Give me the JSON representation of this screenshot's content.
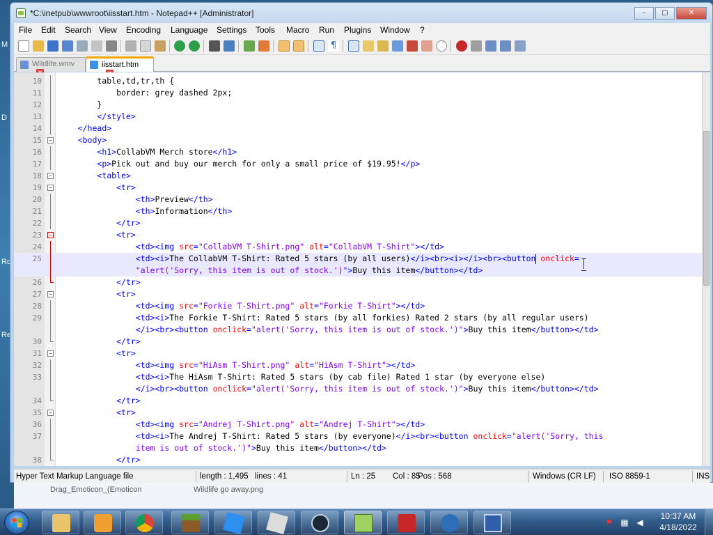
{
  "window": {
    "title": "*C:\\inetpub\\wwwroot\\iisstart.htm - Notepad++ [Administrator]",
    "minimize": "–",
    "maximize": "▢",
    "close": "✕"
  },
  "menu": [
    "File",
    "Edit",
    "Search",
    "View",
    "Encoding",
    "Language",
    "Settings",
    "Tools",
    "Macro",
    "Run",
    "Plugins",
    "Window",
    "?"
  ],
  "tabs": [
    {
      "label": "Wildlife.wmv",
      "active": false
    },
    {
      "label": "iisstart.htm",
      "active": true
    }
  ],
  "editor": {
    "current_line": 25,
    "lines": [
      {
        "n": "10",
        "fold": "line",
        "seg": [
          [
            "tx",
            "        table,td,tr,th {"
          ]
        ]
      },
      {
        "n": "11",
        "fold": "line",
        "seg": [
          [
            "tx",
            "            border: grey dashed 2px;"
          ]
        ]
      },
      {
        "n": "12",
        "fold": "line",
        "seg": [
          [
            "tx",
            "        }"
          ]
        ]
      },
      {
        "n": "13",
        "fold": "line",
        "seg": [
          [
            "tx",
            "        "
          ],
          [
            "t",
            "</style>"
          ]
        ]
      },
      {
        "n": "14",
        "fold": "line",
        "seg": [
          [
            "tx",
            "    "
          ],
          [
            "t",
            "</head>"
          ]
        ]
      },
      {
        "n": "15",
        "fold": "box",
        "seg": [
          [
            "tx",
            "    "
          ],
          [
            "t",
            "<body>"
          ]
        ]
      },
      {
        "n": "16",
        "fold": "line",
        "seg": [
          [
            "tx",
            "        "
          ],
          [
            "t",
            "<h1>"
          ],
          [
            "tx",
            "CollabVM Merch store"
          ],
          [
            "t",
            "</h1>"
          ]
        ]
      },
      {
        "n": "17",
        "fold": "line",
        "seg": [
          [
            "tx",
            "        "
          ],
          [
            "t",
            "<p>"
          ],
          [
            "tx",
            "Pick out and buy our merch for only a small price of $19.95!"
          ],
          [
            "t",
            "</p>"
          ]
        ]
      },
      {
        "n": "18",
        "fold": "box",
        "seg": [
          [
            "tx",
            "        "
          ],
          [
            "t",
            "<table>"
          ]
        ]
      },
      {
        "n": "19",
        "fold": "box",
        "seg": [
          [
            "tx",
            "            "
          ],
          [
            "t",
            "<tr>"
          ]
        ]
      },
      {
        "n": "20",
        "fold": "line",
        "seg": [
          [
            "tx",
            "                "
          ],
          [
            "t",
            "<th>"
          ],
          [
            "tx",
            "Preview"
          ],
          [
            "t",
            "</th>"
          ]
        ]
      },
      {
        "n": "21",
        "fold": "line",
        "seg": [
          [
            "tx",
            "                "
          ],
          [
            "t",
            "<th>"
          ],
          [
            "tx",
            "Information"
          ],
          [
            "t",
            "</th>"
          ]
        ]
      },
      {
        "n": "22",
        "fold": "line",
        "seg": [
          [
            "tx",
            "            "
          ],
          [
            "t",
            "</tr>"
          ]
        ]
      },
      {
        "n": "23",
        "fold": "boxred",
        "seg": [
          [
            "tx",
            "            "
          ],
          [
            "t",
            "<tr>"
          ]
        ]
      },
      {
        "n": "24",
        "fold": "linered",
        "seg": [
          [
            "tx",
            "                "
          ],
          [
            "t",
            "<td><img "
          ],
          [
            "a",
            "src"
          ],
          [
            "t",
            "="
          ],
          [
            "s",
            "\"CollabVM T-Shirt.png\""
          ],
          [
            "t",
            " "
          ],
          [
            "a",
            "alt"
          ],
          [
            "t",
            "="
          ],
          [
            "s",
            "\"CollabVM T-Shirt\""
          ],
          [
            "t",
            "></td>"
          ]
        ]
      },
      {
        "n": "25",
        "fold": "linered",
        "seg": [
          [
            "tx",
            "                "
          ],
          [
            "t",
            "<td><i>"
          ],
          [
            "tx",
            "The CollabVM T-Shirt: Rated 5 stars (by all users)"
          ],
          [
            "t",
            "</i><br><i></i><br><button "
          ],
          [
            "a",
            "onclick"
          ],
          [
            "t",
            "="
          ]
        ]
      },
      {
        "n": "",
        "fold": "linered",
        "seg": [
          [
            "tx",
            "                "
          ],
          [
            "s",
            "\"alert('Sorry, this item is out of stock.')\""
          ],
          [
            "t",
            ">"
          ],
          [
            "tx",
            "Buy this item"
          ],
          [
            "t",
            "</button></td>"
          ]
        ]
      },
      {
        "n": "26",
        "fold": "endred",
        "seg": [
          [
            "tx",
            "            "
          ],
          [
            "t",
            "</tr>"
          ]
        ]
      },
      {
        "n": "27",
        "fold": "box",
        "seg": [
          [
            "tx",
            "            "
          ],
          [
            "t",
            "<tr>"
          ]
        ]
      },
      {
        "n": "28",
        "fold": "line",
        "seg": [
          [
            "tx",
            "                "
          ],
          [
            "t",
            "<td><img "
          ],
          [
            "a",
            "src"
          ],
          [
            "t",
            "="
          ],
          [
            "s",
            "\"Forkie T-Shirt.png\""
          ],
          [
            "t",
            " "
          ],
          [
            "a",
            "alt"
          ],
          [
            "t",
            "="
          ],
          [
            "s",
            "\"Forkie T-Shirt\""
          ],
          [
            "t",
            "></td>"
          ]
        ]
      },
      {
        "n": "29",
        "fold": "line",
        "seg": [
          [
            "tx",
            "                "
          ],
          [
            "t",
            "<td><i>"
          ],
          [
            "tx",
            "The Forkie T-Shirt: Rated 5 stars (by all forkies) Rated 2 stars (by all regular users)"
          ]
        ]
      },
      {
        "n": "",
        "fold": "line",
        "seg": [
          [
            "tx",
            "                "
          ],
          [
            "t",
            "</i><br><button "
          ],
          [
            "a",
            "onclick"
          ],
          [
            "t",
            "="
          ],
          [
            "s",
            "\"alert('Sorry, this item is out of stock.')\""
          ],
          [
            "t",
            ">"
          ],
          [
            "tx",
            "Buy this item"
          ],
          [
            "t",
            "</button></td>"
          ]
        ]
      },
      {
        "n": "30",
        "fold": "end",
        "seg": [
          [
            "tx",
            "            "
          ],
          [
            "t",
            "</tr>"
          ]
        ]
      },
      {
        "n": "31",
        "fold": "box",
        "seg": [
          [
            "tx",
            "            "
          ],
          [
            "t",
            "<tr>"
          ]
        ]
      },
      {
        "n": "32",
        "fold": "line",
        "seg": [
          [
            "tx",
            "                "
          ],
          [
            "t",
            "<td><img "
          ],
          [
            "a",
            "src"
          ],
          [
            "t",
            "="
          ],
          [
            "s",
            "\"HiAsm T-Shirt.png\""
          ],
          [
            "t",
            " "
          ],
          [
            "a",
            "alt"
          ],
          [
            "t",
            "="
          ],
          [
            "s",
            "\"HiAsm T-Shirt\""
          ],
          [
            "t",
            "></td>"
          ]
        ]
      },
      {
        "n": "33",
        "fold": "line",
        "seg": [
          [
            "tx",
            "                "
          ],
          [
            "t",
            "<td><i>"
          ],
          [
            "tx",
            "The HiAsm T-Shirt: Rated 5 stars (by cab file) Rated 1 star (by everyone else)"
          ]
        ]
      },
      {
        "n": "",
        "fold": "line",
        "seg": [
          [
            "tx",
            "                "
          ],
          [
            "t",
            "</i><br><button "
          ],
          [
            "a",
            "onclick"
          ],
          [
            "t",
            "="
          ],
          [
            "s",
            "\"alert('Sorry, this item is out of stock.')\""
          ],
          [
            "t",
            ">"
          ],
          [
            "tx",
            "Buy this item"
          ],
          [
            "t",
            "</button></td>"
          ]
        ]
      },
      {
        "n": "34",
        "fold": "end",
        "seg": [
          [
            "tx",
            "            "
          ],
          [
            "t",
            "</tr>"
          ]
        ]
      },
      {
        "n": "35",
        "fold": "box",
        "seg": [
          [
            "tx",
            "            "
          ],
          [
            "t",
            "<tr>"
          ]
        ]
      },
      {
        "n": "36",
        "fold": "line",
        "seg": [
          [
            "tx",
            "                "
          ],
          [
            "t",
            "<td><img "
          ],
          [
            "a",
            "src"
          ],
          [
            "t",
            "="
          ],
          [
            "s",
            "\"Andrej T-Shirt.png\""
          ],
          [
            "t",
            " "
          ],
          [
            "a",
            "alt"
          ],
          [
            "t",
            "="
          ],
          [
            "s",
            "\"Andrej T-Shirt\""
          ],
          [
            "t",
            "></td>"
          ]
        ]
      },
      {
        "n": "37",
        "fold": "line",
        "seg": [
          [
            "tx",
            "                "
          ],
          [
            "t",
            "<td><i>"
          ],
          [
            "tx",
            "The Andrej T-Shirt: Rated 5 stars (by everyone)"
          ],
          [
            "t",
            "</i><br><button "
          ],
          [
            "a",
            "onclick"
          ],
          [
            "t",
            "="
          ],
          [
            "s",
            "\"alert('Sorry, this"
          ]
        ]
      },
      {
        "n": "",
        "fold": "line",
        "seg": [
          [
            "tx",
            "                "
          ],
          [
            "s",
            "item is out of stock.')\""
          ],
          [
            "t",
            ">"
          ],
          [
            "tx",
            "Buy this item"
          ],
          [
            "t",
            "</button></td>"
          ]
        ]
      },
      {
        "n": "38",
        "fold": "end",
        "seg": [
          [
            "tx",
            "            "
          ],
          [
            "t",
            "</tr>"
          ]
        ]
      }
    ]
  },
  "status": {
    "file_type": "Hyper Text Markup Language file",
    "length": "length : 1,495",
    "lines": "lines : 41",
    "ln": "Ln : 25",
    "col": "Col : 85",
    "pos": "Pos : 568",
    "eol": "Windows (CR LF)",
    "encoding": "ISO 8859-1",
    "mode": "INS"
  },
  "desktop_labels": [
    "M",
    "D",
    "Ro",
    "Re"
  ],
  "behind_window": [
    "Drag_Emoticon_(Emoticon",
    "Wildlife go away.png"
  ],
  "taskbar": {
    "apps": [
      "file-explorer",
      "media-player",
      "chrome",
      "minecraft",
      "roblox-studio",
      "roblox",
      "steam",
      "notepad-plus-plus",
      "dhtml-editor",
      "internet-explorer",
      "remote-desktop"
    ],
    "active_app": "notepad-plus-plus",
    "time": "10:37 AM",
    "date": "4/18/2022"
  },
  "colors": {
    "tag": "#0000ff",
    "attribute": "#ff0000",
    "string": "#8000ff",
    "current_line": "#e8e8ff",
    "active_tab_accent": "#f4a700"
  }
}
